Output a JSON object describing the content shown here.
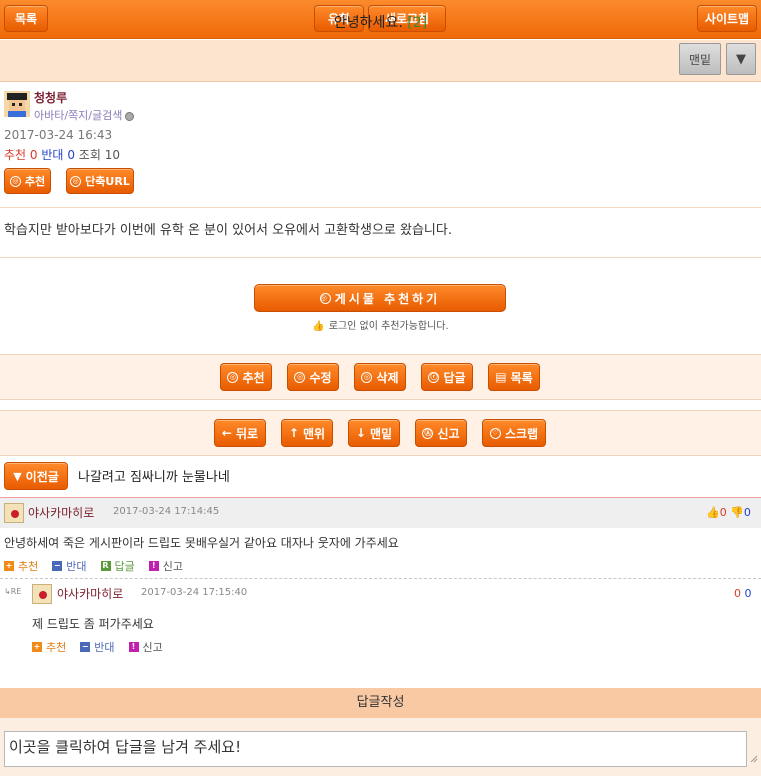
{
  "topbar": {
    "list": "목록",
    "study": "유학",
    "refresh": "새로고침",
    "sitemap": "사이트맵"
  },
  "post": {
    "title": "안녕하세요.",
    "count": "[2]",
    "bottom_btn": "맨밑",
    "down_arrow": "▼",
    "author": "청청루",
    "author_links": "아바타/쪽지/글검색",
    "date": "2017-03-24 16:43",
    "stats": {
      "rec_label": "추천",
      "rec": "0",
      "opp_label": "반대",
      "opp": "0",
      "views_label": "조회",
      "views": "10"
    },
    "btn_recommend": "추천",
    "btn_shorturl": "단축URL",
    "content": "학습지만 받아보다가 이번에 유학 온 분이 있어서 오유에서 고환학생으로 왔습니다.",
    "big_recommend": "게시물 추천하기",
    "rec_note": "로그인 없이 추천가능합니다."
  },
  "actions1": [
    "추천",
    "수정",
    "삭제",
    "답글",
    "목록"
  ],
  "actions2": [
    "뒤로",
    "맨위",
    "맨밑",
    "신고",
    "스크랩"
  ],
  "action_icons1": [
    "◎",
    "◎",
    "◎",
    "ⓡ",
    "▤"
  ],
  "action_icons2": [
    "←",
    "↑",
    "↓",
    "Ⓐ",
    "♡"
  ],
  "prev": {
    "label": "이전글",
    "arrow": "▼",
    "title": "나갈려고 짐싸니까 눈물나네"
  },
  "comments": [
    {
      "name": "야사카마히로",
      "time": "2017-03-24 17:14:45",
      "text": "안녕하세여 죽은 게시판이라 드립도 못배우실거 같아요 대자나 웃자에 가주세요",
      "up": "0",
      "down": "0",
      "actions": {
        "rec": "추천",
        "opp": "반대",
        "reply": "답글",
        "report": "신고"
      }
    },
    {
      "name": "야사카마히로",
      "time": "2017-03-24 17:15:40",
      "text": "제 드립도 좀 퍼가주세요",
      "up": "0",
      "down": "0",
      "re": "RE",
      "actions": {
        "rec": "추천",
        "opp": "반대",
        "report": "신고"
      }
    }
  ],
  "reply": {
    "header": "답글작성",
    "placeholder": "이곳을 클릭하여 답글을 남겨 주세요!"
  },
  "colors": {
    "accent": "#f06a08",
    "title_bg": "#fde4cf",
    "recommend": "#d93a2a",
    "oppose": "#2244cc"
  }
}
